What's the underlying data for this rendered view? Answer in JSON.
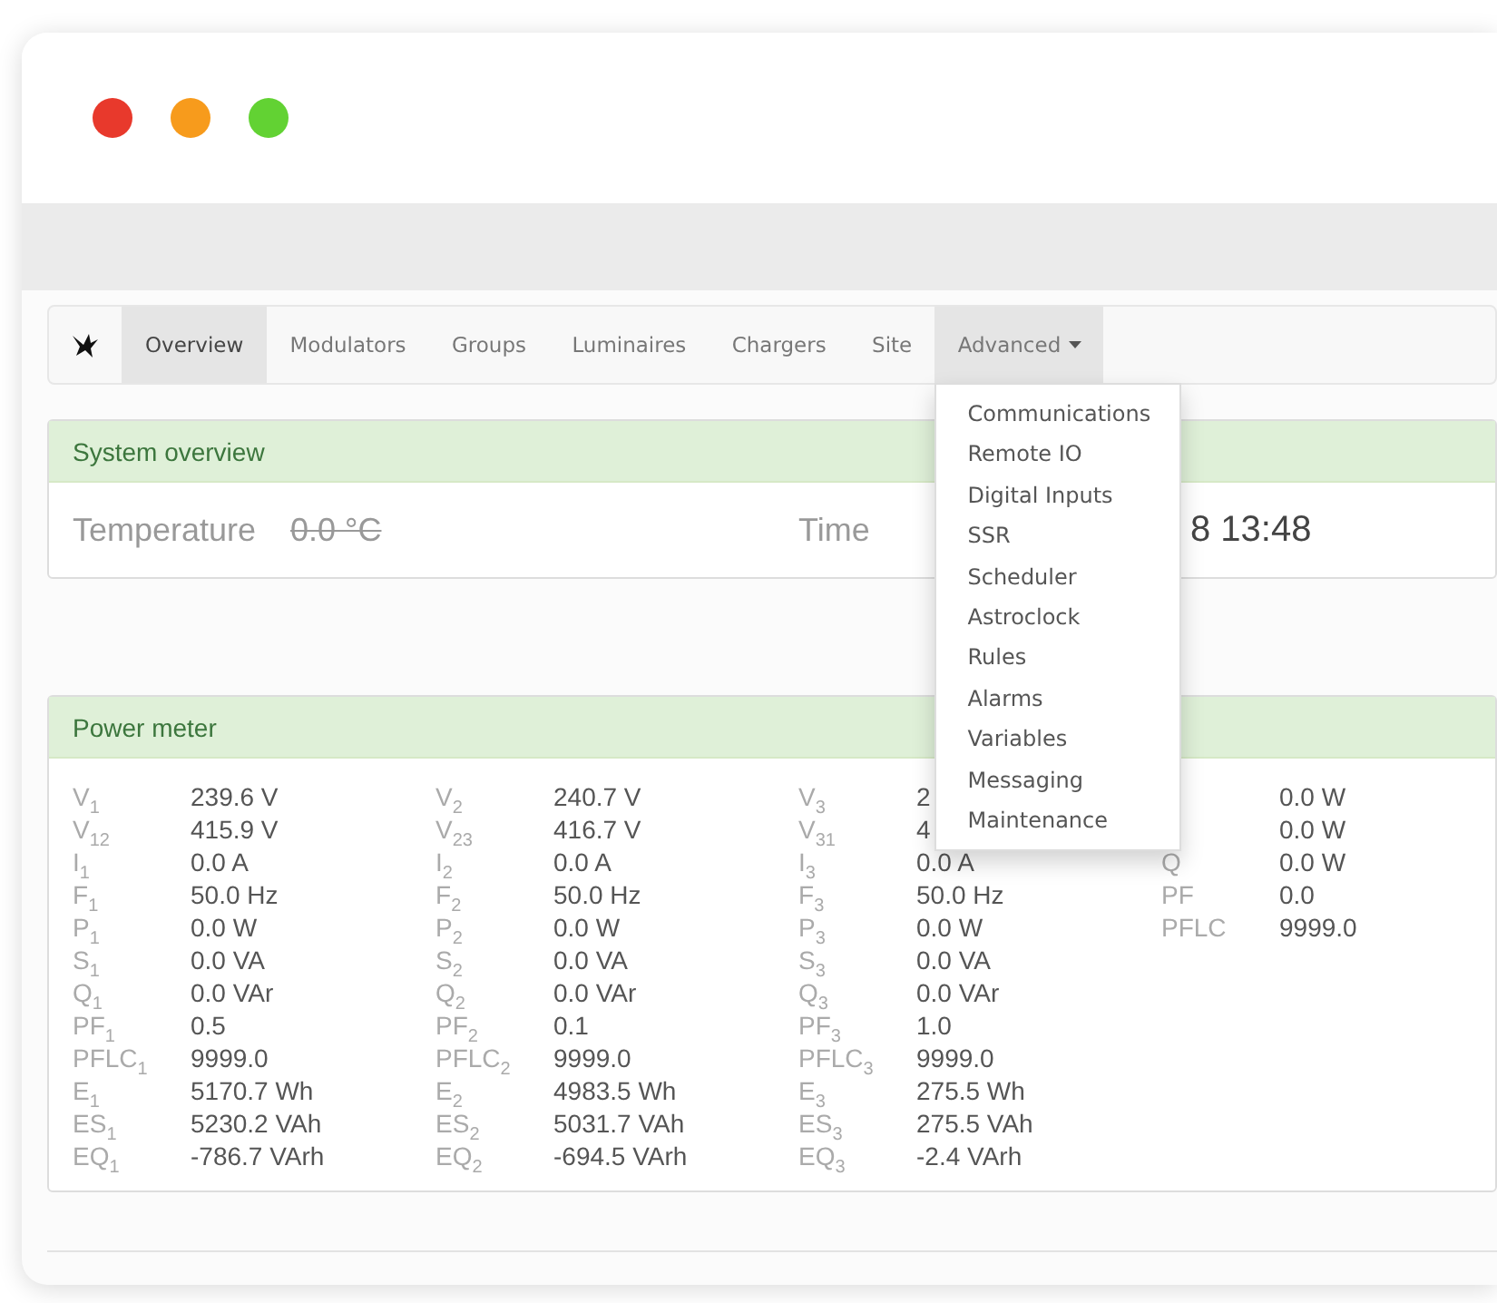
{
  "window": {
    "controls": [
      {
        "color": "#e8392c"
      },
      {
        "color": "#f79b1c"
      },
      {
        "color": "#62d233"
      }
    ]
  },
  "nav": {
    "items": [
      {
        "label": "Overview",
        "selected": true
      },
      {
        "label": "Modulators",
        "selected": false
      },
      {
        "label": "Groups",
        "selected": false
      },
      {
        "label": "Luminaires",
        "selected": false
      },
      {
        "label": "Chargers",
        "selected": false
      },
      {
        "label": "Site",
        "selected": false
      },
      {
        "label": "Advanced",
        "selected": false,
        "expanded": true,
        "menu": [
          "Communications",
          "Remote IO",
          "Digital Inputs",
          "SSR",
          "Scheduler",
          "Astroclock",
          "Rules",
          "Alarms",
          "Variables",
          "Messaging",
          "Maintenance"
        ]
      }
    ]
  },
  "system_overview": {
    "title": "System overview",
    "fields": [
      {
        "label": "Temperature",
        "value": "0.0 °C",
        "stale": true
      },
      {
        "label": "Time",
        "value": "8 13:48",
        "stale": false
      }
    ]
  },
  "power_meter": {
    "title": "Power meter",
    "columns": [
      [
        {
          "label": "V$_{1}$",
          "value": "239.6 V"
        },
        {
          "label": "V$_{12}$",
          "value": "415.9 V"
        },
        {
          "label": "I$_{1}$",
          "value": "0.0 A"
        },
        {
          "label": "F$_{1}$",
          "value": "50.0 Hz"
        },
        {
          "label": "P$_{1}$",
          "value": "0.0 W"
        },
        {
          "label": "S$_{1}$",
          "value": "0.0 VA"
        },
        {
          "label": "Q$_{1}$",
          "value": "0.0 VAr"
        },
        {
          "label": "PF$_{1}$",
          "value": "0.5"
        },
        {
          "label": "PFLC$_{1}$",
          "value": "9999.0"
        },
        {
          "label": "E$_{1}$",
          "value": "5170.7 Wh"
        },
        {
          "label": "ES$_{1}$",
          "value": "5230.2 VAh"
        },
        {
          "label": "EQ$_{1}$",
          "value": "-786.7 VArh"
        }
      ],
      [
        {
          "label": "V$_{2}$",
          "value": "240.7 V"
        },
        {
          "label": "V$_{23}$",
          "value": "416.7 V"
        },
        {
          "label": "I$_{2}$",
          "value": "0.0 A"
        },
        {
          "label": "F$_{2}$",
          "value": "50.0 Hz"
        },
        {
          "label": "P$_{2}$",
          "value": "0.0 W"
        },
        {
          "label": "S$_{2}$",
          "value": "0.0 VA"
        },
        {
          "label": "Q$_{2}$",
          "value": "0.0 VAr"
        },
        {
          "label": "PF$_{2}$",
          "value": "0.1"
        },
        {
          "label": "PFLC$_{2}$",
          "value": "9999.0"
        },
        {
          "label": "E$_{2}$",
          "value": "4983.5 Wh"
        },
        {
          "label": "ES$_{2}$",
          "value": "5031.7 VAh"
        },
        {
          "label": "EQ$_{2}$",
          "value": "-694.5 VArh"
        }
      ],
      [
        {
          "label": "V$_{3}$",
          "value": "2"
        },
        {
          "label": "V$_{31}$",
          "value": "4"
        },
        {
          "label": "I$_{3}$",
          "value": "0.0 A"
        },
        {
          "label": "F$_{3}$",
          "value": "50.0 Hz"
        },
        {
          "label": "P$_{3}$",
          "value": "0.0 W"
        },
        {
          "label": "S$_{3}$",
          "value": "0.0 VA"
        },
        {
          "label": "Q$_{3}$",
          "value": "0.0 VAr"
        },
        {
          "label": "PF$_{3}$",
          "value": "1.0"
        },
        {
          "label": "PFLC$_{3}$",
          "value": "9999.0"
        },
        {
          "label": "E$_{3}$",
          "value": "275.5 Wh"
        },
        {
          "label": "ES$_{3}$",
          "value": "275.5 VAh"
        },
        {
          "label": "EQ$_{3}$",
          "value": "-2.4 VArh"
        }
      ],
      [
        {
          "value": "0.0 W"
        },
        {
          "value": "0.0 W"
        },
        {
          "label": "Q",
          "value": "0.0 W"
        },
        {
          "label": "PF",
          "value": "0.0"
        },
        {
          "label": "PFLC",
          "value": "9999.0"
        }
      ]
    ]
  }
}
